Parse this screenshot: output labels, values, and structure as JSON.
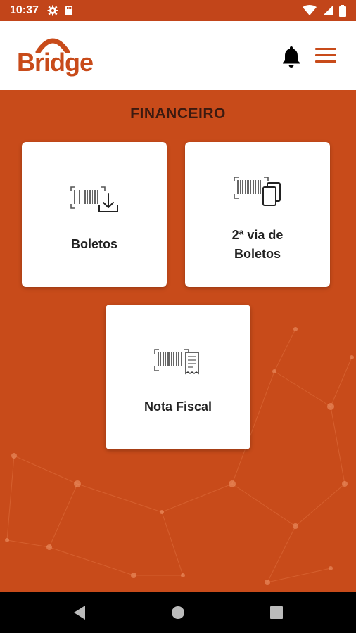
{
  "status_bar": {
    "time": "10:37",
    "left_icons": [
      "gear-icon",
      "sd-card-icon"
    ],
    "right_icons": [
      "wifi-icon",
      "signal-icon",
      "battery-icon"
    ]
  },
  "header": {
    "logo_text": "Bridge",
    "brand_color": "#c84b1a"
  },
  "page": {
    "title": "FINANCEIRO"
  },
  "cards": [
    {
      "label": "Boletos",
      "icon": "barcode-download-icon"
    },
    {
      "label_line1": "2ª via de",
      "label_line2": "Boletos",
      "icon": "barcode-copy-icon"
    },
    {
      "label": "Nota Fiscal",
      "icon": "barcode-invoice-icon"
    }
  ],
  "nav": {
    "buttons": [
      "back-icon",
      "home-icon",
      "recents-icon"
    ]
  }
}
